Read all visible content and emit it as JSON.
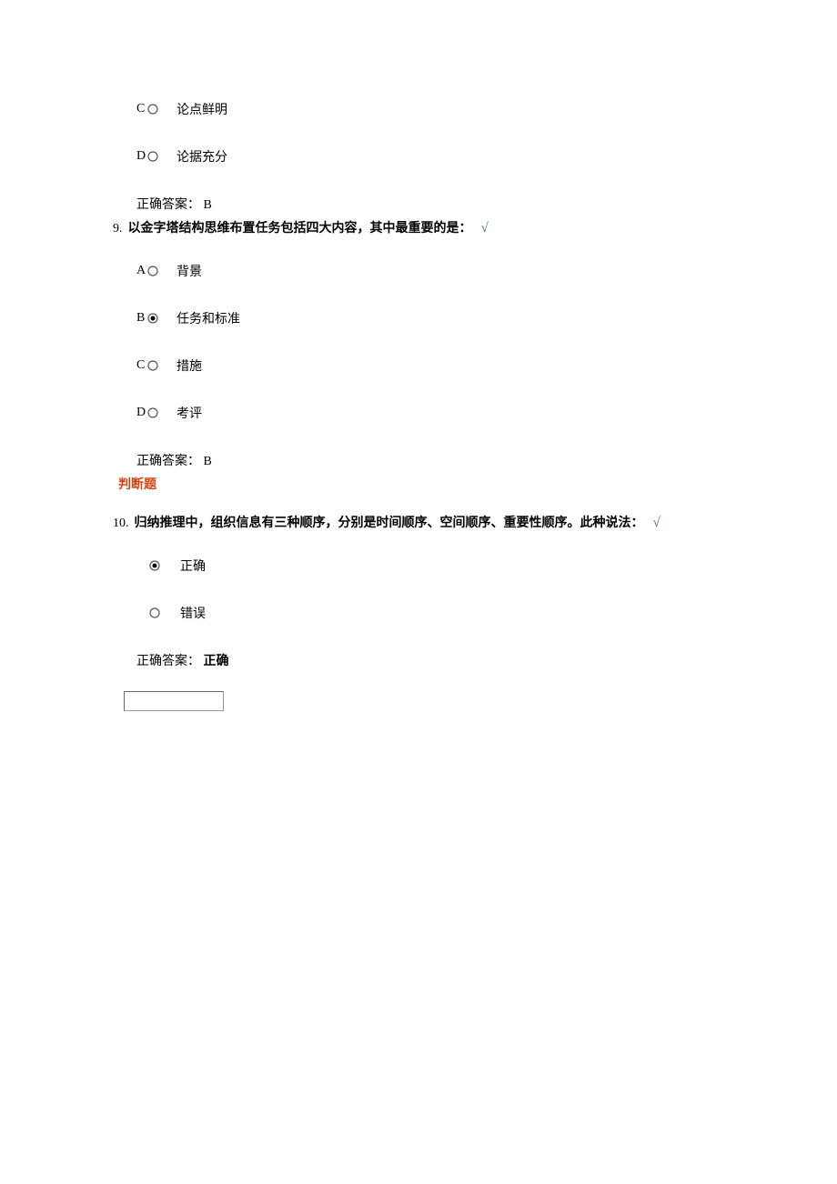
{
  "partial_question_8": {
    "options": [
      {
        "letter": "C",
        "text": "论点鲜明",
        "selected": false
      },
      {
        "letter": "D",
        "text": "论据充分",
        "selected": false
      }
    ],
    "answer_label": "正确答案：",
    "answer_value": "B"
  },
  "question_9": {
    "number": "9.",
    "text": "以金字塔结构思维布置任务包括四大内容，其中最重要的是：",
    "correct_mark": "√",
    "options": [
      {
        "letter": "A",
        "text": "背景",
        "selected": false
      },
      {
        "letter": "B",
        "text": "任务和标准",
        "selected": true
      },
      {
        "letter": "C",
        "text": "措施",
        "selected": false
      },
      {
        "letter": "D",
        "text": "考评",
        "selected": false
      }
    ],
    "answer_label": "正确答案：",
    "answer_value": "B"
  },
  "section_heading": "判断题",
  "question_10": {
    "number": "10.",
    "text": "归纳推理中，组织信息有三种顺序，分别是时间顺序、空间顺序、重要性顺序。此种说法：",
    "correct_mark": "√",
    "options": [
      {
        "text": "正确",
        "selected": true
      },
      {
        "text": "错误",
        "selected": false
      }
    ],
    "answer_label": "正确答案：",
    "answer_value": "正确"
  },
  "input_value": ""
}
